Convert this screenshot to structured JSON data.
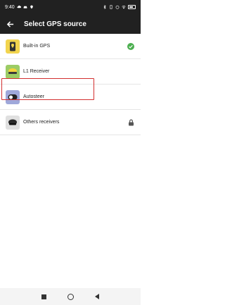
{
  "status": {
    "time": "9:40",
    "left_icons": [
      "cloud-icon",
      "car-icon",
      "location-icon"
    ],
    "right_icons": [
      "bluetooth-icon",
      "vibrate-icon",
      "alarm-icon",
      "wifi-icon",
      "battery-icon"
    ]
  },
  "header": {
    "title": "Select GPS source",
    "back_icon": "arrow-left-icon"
  },
  "sources": [
    {
      "label": "Built-in GPS",
      "icon": "phone-pin-icon",
      "icon_bg": "#f2d44e",
      "trailing": "check-circle-icon"
    },
    {
      "label": "L1 Receiver",
      "icon": "receiver-dome-icon",
      "icon_bg": "#9ccc65",
      "trailing": ""
    },
    {
      "label": "Autosteer",
      "icon": "autosteer-icon",
      "icon_bg": "#9fa8da",
      "trailing": ""
    },
    {
      "label": "Others receivers",
      "icon": "receiver-black-icon",
      "icon_bg": "#e0e0e0",
      "trailing": "lock-icon"
    }
  ],
  "colors": {
    "bar": "#212121",
    "check": "#4caf50",
    "highlight": "#d32f2f"
  },
  "navbar": {
    "icons": [
      "recents-square-icon",
      "home-circle-icon",
      "back-triangle-icon"
    ]
  }
}
